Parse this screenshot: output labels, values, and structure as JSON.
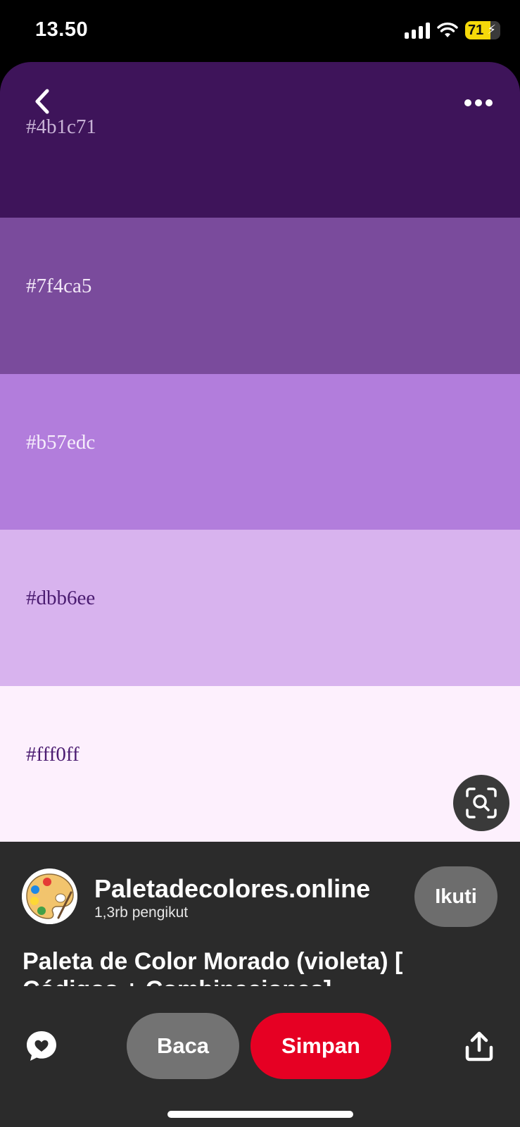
{
  "status_bar": {
    "time": "13.50",
    "battery_level": "71"
  },
  "palette": [
    {
      "hex": "#4b1c71",
      "background": "#3e145a",
      "label_color": "#c8b3d6"
    },
    {
      "hex": "#7f4ca5",
      "background": "#7a4b9c",
      "label_color": "#f2e7f7"
    },
    {
      "hex": "#b57edc",
      "background": "#b27ddc",
      "label_color": "#f6eefb"
    },
    {
      "hex": "#dbb6ee",
      "background": "#d8b3ee",
      "label_color": "#4b1c71"
    },
    {
      "hex": "#fff0ff",
      "background": "#fdf0fd",
      "label_color": "#4b1c71"
    }
  ],
  "icons": {
    "back": "chevron-left-icon",
    "more": "ellipsis-icon",
    "lens": "visual-search-icon",
    "comment": "heart-bubble-icon",
    "share": "share-upload-icon"
  },
  "profile": {
    "name": "Paletadecolores.online",
    "followers": "1,3rb pengikut",
    "follow_label": "Ikuti"
  },
  "pin": {
    "title": "Paleta de Color Morado (violeta) [ Códigos + Combinaciones]"
  },
  "actions": {
    "read_label": "Baca",
    "save_label": "Simpan"
  },
  "colors": {
    "save_red": "#e60023",
    "sheet_bg": "#2b2b2b"
  }
}
